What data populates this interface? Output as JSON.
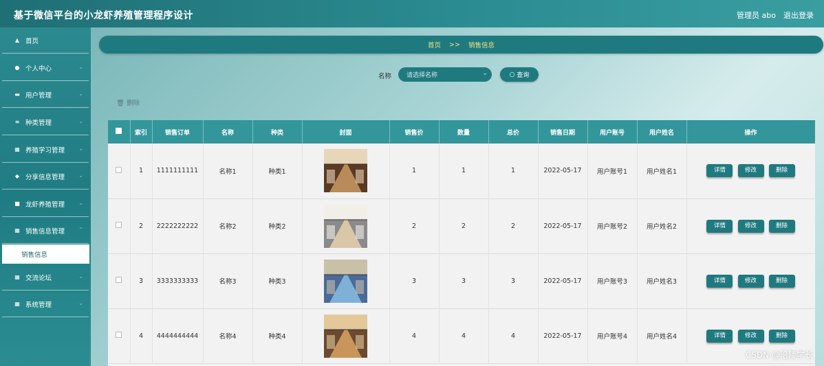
{
  "header": {
    "title": "基于微信平台的小龙虾养殖管理程序设计",
    "user": "管理员 abo",
    "logout": "退出登录"
  },
  "sidebar": {
    "items": [
      {
        "label": "首页",
        "icon": "home-icon"
      },
      {
        "label": "个人中心",
        "icon": "user-icon"
      },
      {
        "label": "用户管理",
        "icon": "card-icon"
      },
      {
        "label": "种类管理",
        "icon": "sliders-icon"
      },
      {
        "label": "养殖学习管理",
        "icon": "grid-icon"
      },
      {
        "label": "分享信息管理",
        "icon": "pin-icon"
      },
      {
        "label": "龙虾养殖管理",
        "icon": "board-icon"
      },
      {
        "label": "销售信息管理",
        "icon": "grid-icon"
      },
      {
        "label": "交流论坛",
        "icon": "grid-icon"
      },
      {
        "label": "系统管理",
        "icon": "grid-icon"
      }
    ],
    "active_sub": "销售信息"
  },
  "breadcrumb": {
    "home": "首页",
    "sep": ">>",
    "current": "销售信息"
  },
  "search": {
    "label": "名称",
    "placeholder": "请选择名称",
    "button": "查询"
  },
  "toolbar": {
    "delete": "删除"
  },
  "table": {
    "headers": [
      "索引",
      "销售订单",
      "名称",
      "种类",
      "封面",
      "销售价",
      "数量",
      "总价",
      "销售日期",
      "用户账号",
      "用户姓名",
      "操作"
    ],
    "actions": {
      "detail": "详情",
      "edit": "修改",
      "delete": "删除"
    },
    "rows": [
      {
        "index": "1",
        "order": "1111111111",
        "name": "名称1",
        "type": "种类1",
        "price": "1",
        "qty": "1",
        "total": "1",
        "date": "2022-05-17",
        "account": "用户账号1",
        "username": "用户姓名1"
      },
      {
        "index": "2",
        "order": "2222222222",
        "name": "名称2",
        "type": "种类2",
        "price": "2",
        "qty": "2",
        "total": "2",
        "date": "2022-05-17",
        "account": "用户账号2",
        "username": "用户姓名2"
      },
      {
        "index": "3",
        "order": "3333333333",
        "name": "名称3",
        "type": "种类3",
        "price": "3",
        "qty": "3",
        "total": "3",
        "date": "2022-05-17",
        "account": "用户账号3",
        "username": "用户姓名3"
      },
      {
        "index": "4",
        "order": "4444444444",
        "name": "名称4",
        "type": "种类4",
        "price": "4",
        "qty": "4",
        "total": "4",
        "date": "2022-05-17",
        "account": "用户账号4",
        "username": "用户姓名4"
      }
    ]
  },
  "watermark": "CSDN @涪陵学长"
}
